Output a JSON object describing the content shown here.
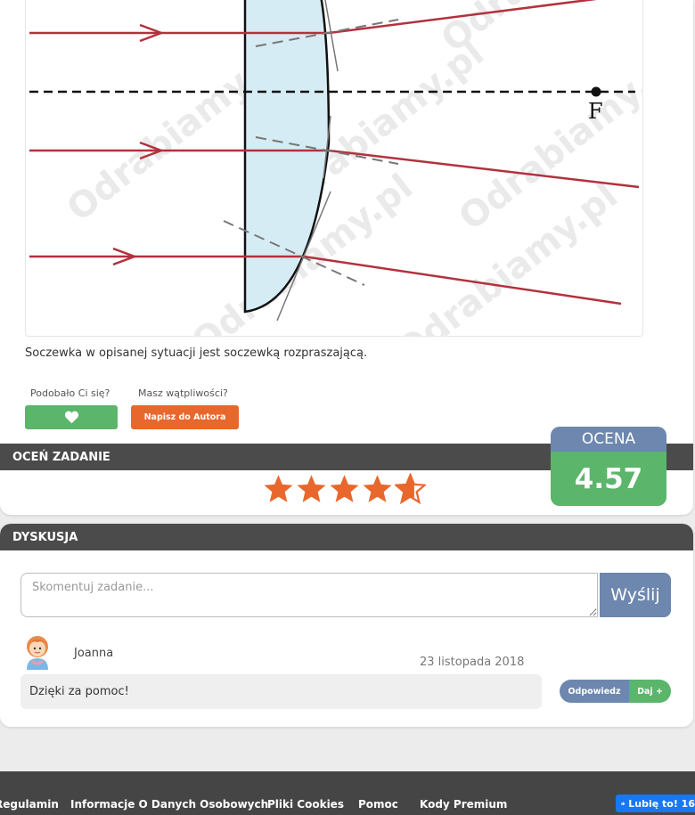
{
  "solution": {
    "figure_label_focus": "F",
    "watermark": "Odrabiamy.pl",
    "caption": "Soczewka w opisanej sytuacji jest soczewką rozpraszającą."
  },
  "feedback": {
    "liked_question": "Podobało Ci się?",
    "doubts_question": "Masz wątpliwości?",
    "like_icon": "heart-icon",
    "write_author_label": "Napisz do Autora"
  },
  "rating": {
    "header": "OCEŃ ZADANIE",
    "stars_filled": 4.57,
    "stars_total": 5,
    "score_label": "OCENA",
    "score_value": "4.57",
    "colors": {
      "star": "#e8672c",
      "score_head": "#6d87ae",
      "score_value": "#5bb56a"
    }
  },
  "discussion": {
    "header": "DYSKUSJA",
    "input_placeholder": "Skomentuj zadanie...",
    "send_label": "Wyślij",
    "comments": [
      {
        "author": "Joanna",
        "date": "23 listopada 2018",
        "text": "Dzięki za pomoc!",
        "reply_label": "Odpowiedz",
        "plus_label": "Daj +"
      }
    ]
  },
  "footer": {
    "links": [
      "Regulamin",
      "Informacje O Danych Osobowych",
      "Pliki Cookies",
      "Pomoc",
      "Kody Premium"
    ],
    "fb_like_label": "Lubię to! 16"
  }
}
